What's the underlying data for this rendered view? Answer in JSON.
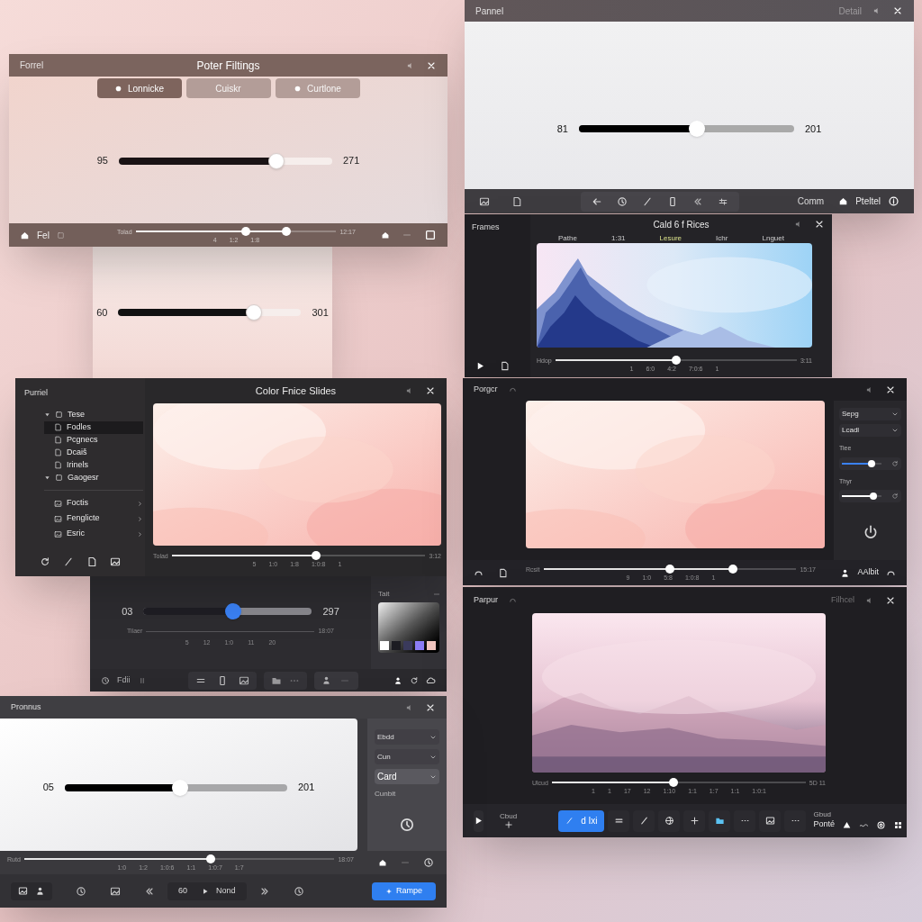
{
  "filters_window": {
    "app_label": "Forrel",
    "title": "Poter Filtings",
    "tabs": [
      {
        "label": "Lonnicke",
        "selected": true
      },
      {
        "label": "Cuiskr",
        "selected": false
      },
      {
        "label": "Curtlone",
        "selected": false
      }
    ],
    "slider": {
      "min": "95",
      "max": "271",
      "level": 0.74
    },
    "footer_label": "Fel",
    "timeline": {
      "start": "Tolad",
      "end": "12:17",
      "handles": [
        {
          "level": 0.55
        },
        {
          "level": 0.75
        }
      ],
      "ticks": [
        "4",
        "1:2",
        "1:8"
      ]
    }
  },
  "lower_panel": {
    "slider": {
      "min": "60",
      "max": "301",
      "level": 0.74
    }
  },
  "pannel_window": {
    "app_label": "Pannel",
    "detail": "Detail",
    "slider": {
      "min": "81",
      "max": "201",
      "level": 0.55
    },
    "footer_texts": [
      "Comm",
      "Pteltel"
    ]
  },
  "frames_window": {
    "sidebar_label": "Frames",
    "title": "Cald 6 f Rices",
    "tabs": [
      {
        "label": "Pathe",
        "selected": false
      },
      {
        "label": "1:31",
        "selected": false
      },
      {
        "label": "Lesure",
        "selected": true
      },
      {
        "label": "Ichr",
        "selected": false
      },
      {
        "label": "Lnguet",
        "selected": false
      }
    ],
    "timeline": {
      "start": "Hdop",
      "end": "3:11",
      "handles": [
        {
          "level": 0.5
        }
      ],
      "ticks": [
        "1",
        "6:0",
        "4:2",
        "7:0:6",
        "1"
      ]
    }
  },
  "color_slides_window": {
    "sidebar_label": "Purriel",
    "title": "Color Fnice Slides",
    "tree": [
      {
        "label": "Tese",
        "expanded": true,
        "selected": false,
        "children": [
          {
            "label": "Fodles",
            "selected": true
          },
          {
            "label": "Pcgnecs",
            "selected": false
          },
          {
            "label": "Dcaiš",
            "selected": false
          },
          {
            "label": "Irinels",
            "selected": false
          }
        ]
      },
      {
        "label": "Gaogesr",
        "expanded": true,
        "selected": false
      }
    ],
    "links": [
      {
        "label": "Foctis"
      },
      {
        "label": "Fenglicte"
      },
      {
        "label": "Esric"
      }
    ],
    "timeline": {
      "start": "Tolad",
      "end": "3:12",
      "handles": [
        {
          "level": 0.57
        }
      ],
      "ticks": [
        "5",
        "1:0",
        "1:8",
        "1:0:8",
        "1"
      ]
    }
  },
  "dark_slider_panel": {
    "slider": {
      "min": "03",
      "max": "297",
      "level": 0.53
    },
    "timeline_start": "Tilaer",
    "timeline_end": "18:07",
    "ticks": [
      "5",
      "12",
      "1:0",
      "11",
      "20"
    ],
    "picker_label": "Tait",
    "swatches": [
      {
        "color": "#ffffff"
      },
      {
        "color": "#1c1c22"
      },
      {
        "color": "#3a3a5c"
      },
      {
        "color": "#8b7cf6"
      },
      {
        "color": "#f2c6c0"
      }
    ],
    "footer_label": "Fdii"
  },
  "porgcr_window": {
    "app_label": "Porgcr",
    "fields": [
      {
        "kind": "dropdown",
        "label": "Sepg"
      },
      {
        "kind": "dropdown",
        "label": "Lcadl"
      },
      {
        "kind": "slider",
        "label": "Tiee",
        "level": 0.75
      },
      {
        "kind": "slider",
        "label": "Thyr",
        "level": 0.8
      }
    ],
    "timeline": {
      "start": "Rcsit",
      "end": "15:17",
      "handles": [
        {
          "level": 0.5
        },
        {
          "level": 0.75
        }
      ],
      "ticks": [
        "9",
        "1:0",
        "5:8",
        "1:0:8",
        "1"
      ]
    },
    "footer_label": "AAlbit"
  },
  "perpur_window": {
    "app_label": "Parpur",
    "detail": "Filhcel",
    "timeline": {
      "start": "Ulcud",
      "end": "5D 11",
      "handles": [
        {
          "level": 0.48
        }
      ],
      "ticks": [
        "1",
        "1",
        "17",
        "12",
        "1:10",
        "1:1",
        "1:7",
        "1:1",
        "1:0:1"
      ]
    },
    "add_label": "Cbud",
    "tool_button": "d Ixi",
    "right_caption": "Gbud",
    "right_label": "Ponté"
  },
  "pronnus_window": {
    "app_label": "Pronnus",
    "slider": {
      "min": "05",
      "max": "201",
      "level": 0.52
    },
    "dropdowns": [
      {
        "label": "Ebdd",
        "selected": false
      },
      {
        "label": "Cun",
        "selected": false
      },
      {
        "label": "Card",
        "selected": true
      }
    ],
    "panel_hint": "Cunbit",
    "timeline": {
      "start": "Rutd",
      "end": "18:07",
      "handles": [
        {
          "level": 0.6
        }
      ],
      "ticks": [
        "1:0",
        "1:2",
        "1:0:6",
        "1:1",
        "1:0:7",
        "1:7"
      ]
    },
    "page_value": "60",
    "next_label": "Nond",
    "action_button": "Rampe"
  }
}
